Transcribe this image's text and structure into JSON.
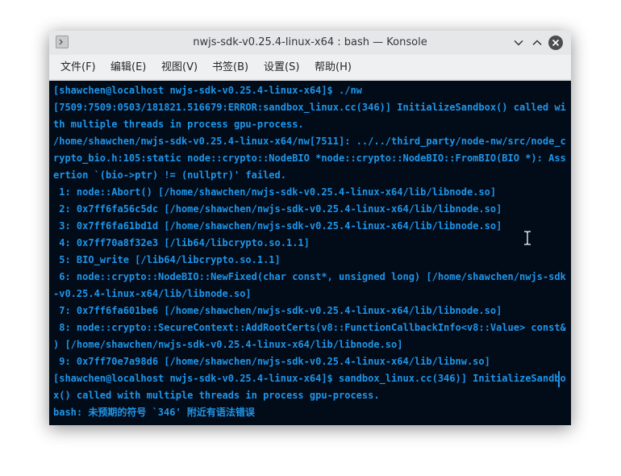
{
  "window": {
    "title": "nwjs-sdk-v0.25.4-linux-x64 : bash — Konsole"
  },
  "icons": {
    "app": "terminal-app-icon",
    "minimize": "chevron-down-icon",
    "maximize": "chevron-up-icon",
    "close": "close-icon",
    "mouse": "text-cursor-icon"
  },
  "menu": {
    "items": [
      {
        "label": "文件(F)"
      },
      {
        "label": "编辑(E)"
      },
      {
        "label": "视图(V)"
      },
      {
        "label": "书签(B)"
      },
      {
        "label": "设置(S)"
      },
      {
        "label": "帮助(H)"
      }
    ]
  },
  "terminal": {
    "lines": [
      "[shawchen@localhost nwjs-sdk-v0.25.4-linux-x64]$ ./nw",
      "[7509:7509:0503/181821.516679:ERROR:sandbox_linux.cc(346)] InitializeSandbox() called wi",
      "th multiple threads in process gpu-process.",
      "/home/shawchen/nwjs-sdk-v0.25.4-linux-x64/nw[7511]: ../../third_party/node-nw/src/node_c",
      "rypto_bio.h:105:static node::crypto::NodeBIO *node::crypto::NodeBIO::FromBIO(BIO *): Ass",
      "ertion `(bio->ptr) != (nullptr)' failed.",
      " 1: node::Abort() [/home/shawchen/nwjs-sdk-v0.25.4-linux-x64/lib/libnode.so]",
      " 2: 0x7ff6fa56c5dc [/home/shawchen/nwjs-sdk-v0.25.4-linux-x64/lib/libnode.so]",
      " 3: 0x7ff6fa61bd1d [/home/shawchen/nwjs-sdk-v0.25.4-linux-x64/lib/libnode.so]",
      " 4: 0x7ff70a8f32e3 [/lib64/libcrypto.so.1.1]",
      " 5: BIO_write [/lib64/libcrypto.so.1.1]",
      " 6: node::crypto::NodeBIO::NewFixed(char const*, unsigned long) [/home/shawchen/nwjs-sdk",
      "-v0.25.4-linux-x64/lib/libnode.so]",
      " 7: 0x7ff6fa601be6 [/home/shawchen/nwjs-sdk-v0.25.4-linux-x64/lib/libnode.so]",
      " 8: node::crypto::SecureContext::AddRootCerts(v8::FunctionCallbackInfo<v8::Value> const&",
      ") [/home/shawchen/nwjs-sdk-v0.25.4-linux-x64/lib/libnode.so]",
      " 9: 0x7ff70e7a98d6 [/home/shawchen/nwjs-sdk-v0.25.4-linux-x64/lib/libnw.so]",
      "[shawchen@localhost nwjs-sdk-v0.25.4-linux-x64]$ sandbox_linux.cc(346)] InitializeSandbo",
      "x() called with multiple threads in process gpu-process.",
      "bash: 未预期的符号 `346' 附近有语法错误"
    ]
  },
  "colors": {
    "terminal_bg": "#020b18",
    "terminal_fg": "#1f95e8",
    "titlebar_bg": "#e6e7e8",
    "menubar_bg": "#eff0f1"
  }
}
